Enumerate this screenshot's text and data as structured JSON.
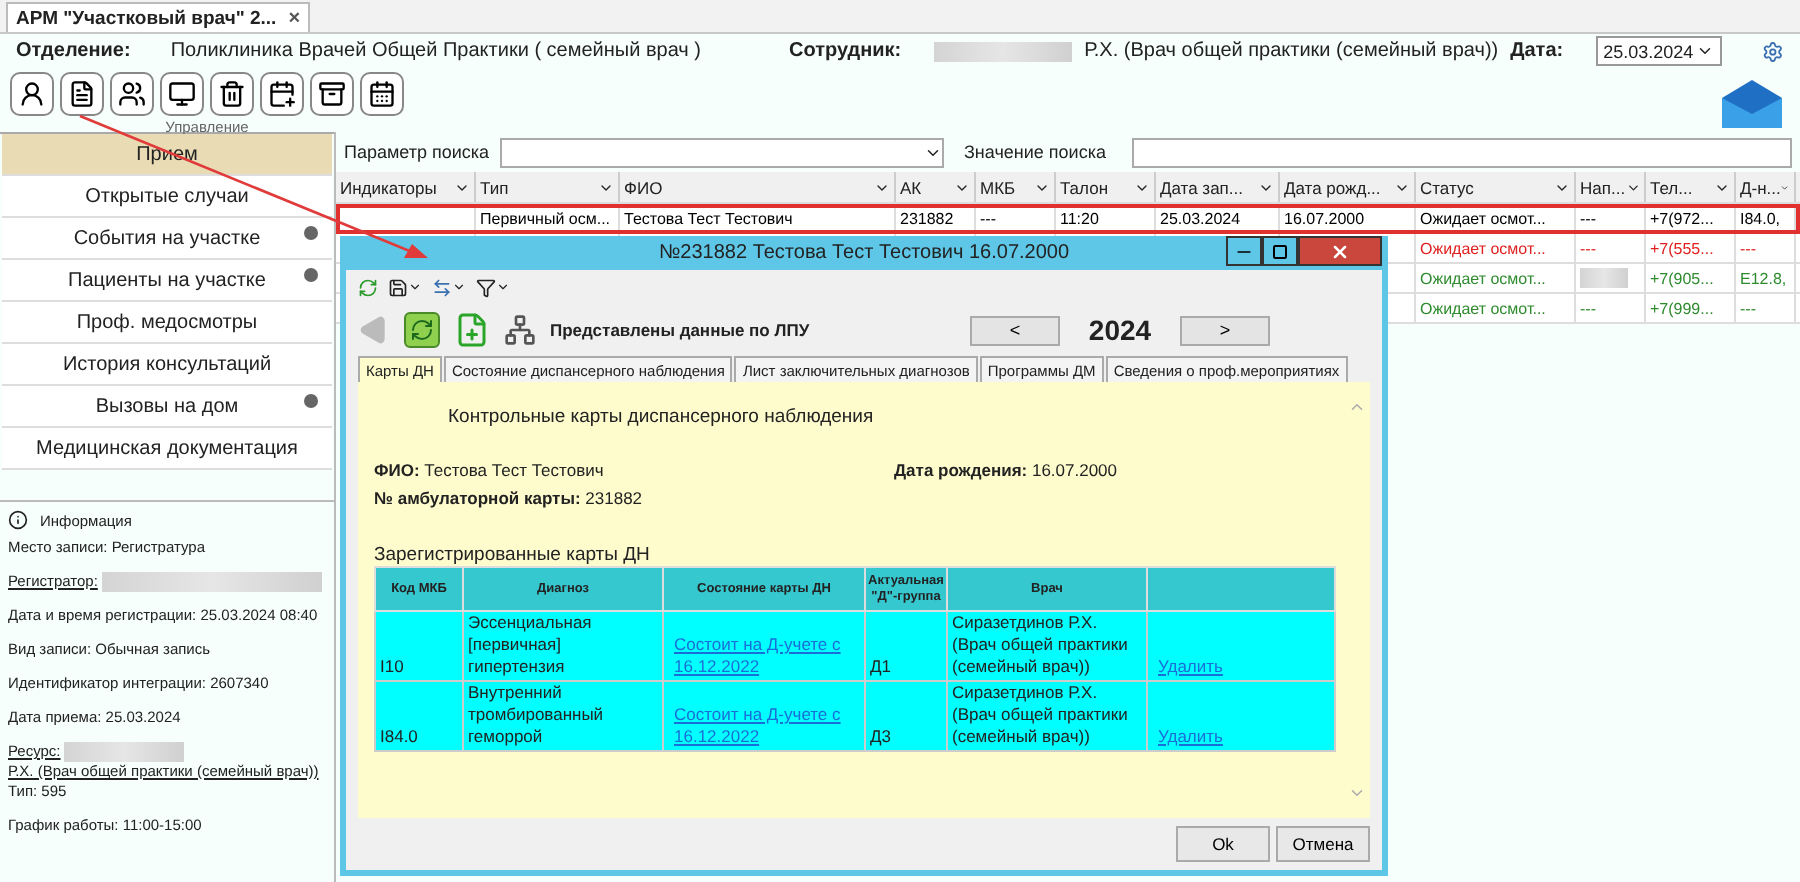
{
  "app_tab": {
    "title": "АРМ \"Участковый врач\" 2...",
    "close": "×"
  },
  "header": {
    "department_label": "Отделение:",
    "department": "Поликлиника Врачей Общей Практики ( семейный врач )",
    "employee_label": "Сотрудник:",
    "employee": "Р.Х. (Врач общей практики (семейный врач))",
    "date_label": "Дата:",
    "date": "25.03.2024"
  },
  "toolbar": {
    "group_label": "Управление"
  },
  "sidebar": {
    "items": [
      {
        "label": "Прием",
        "selected": true,
        "dot": false
      },
      {
        "label": "Открытые случаи",
        "selected": false,
        "dot": false
      },
      {
        "label": "События на участке",
        "selected": false,
        "dot": true
      },
      {
        "label": "Пациенты на участке",
        "selected": false,
        "dot": true
      },
      {
        "label": "Проф. медосмотры",
        "selected": false,
        "dot": false
      },
      {
        "label": "История консультаций",
        "selected": false,
        "dot": false
      },
      {
        "label": "Вызовы на дом",
        "selected": false,
        "dot": true
      },
      {
        "label": "Медицинская документация",
        "selected": false,
        "dot": false
      }
    ]
  },
  "info": {
    "title": "Информация",
    "fields": [
      {
        "kind": "text",
        "text": "Место записи: Регистратура"
      },
      {
        "kind": "link",
        "label": "Регистратор:",
        "redacted": true
      },
      {
        "kind": "text",
        "text": "Дата и время регистрации: 25.03.2024 08:40"
      },
      {
        "kind": "text",
        "text": "Вид записи: Обычная запись"
      },
      {
        "kind": "text",
        "text": "Идентификатор интеграции: 2607340"
      },
      {
        "kind": "text",
        "text": "Дата приема: 25.03.2024"
      },
      {
        "kind": "link",
        "label": "Ресурс:",
        "redacted": true,
        "text": "Р.Х. (Врач общей практики (семейный врач))"
      },
      {
        "kind": "note",
        "text": "Тип: 595"
      },
      {
        "kind": "text",
        "text": "График работы: 11:00-15:00"
      }
    ]
  },
  "search": {
    "param_label": "Параметр поиска",
    "value_label": "Значение поиска"
  },
  "table": {
    "columns": [
      "Индикаторы",
      "Тип",
      "ФИО",
      "АК",
      "МКБ",
      "Талон",
      "Дата зап...",
      "Дата рожд...",
      "Статус",
      "Нап...",
      "Тел...",
      "Д-н..."
    ],
    "rows": [
      {
        "selected": true,
        "redacted": false,
        "color": "#000000",
        "cells": [
          null,
          "Первичный осм...",
          "Тестова Тест Тестович",
          "231882",
          "---",
          "11:20",
          "25.03.2024",
          "16.07.2000",
          "Ожидает осмот...",
          "---",
          "+7(972...",
          "I84.0,"
        ]
      },
      {
        "selected": false,
        "redacted": false,
        "color": "#e02020",
        "cells": [
          null,
          null,
          null,
          null,
          null,
          null,
          null,
          null,
          "Ожидает осмот...",
          "---",
          "+7(555...",
          "---"
        ]
      },
      {
        "selected": false,
        "redacted": true,
        "color": "#2e8b2e",
        "cells": [
          null,
          null,
          null,
          null,
          null,
          null,
          null,
          null,
          "Ожидает осмот...",
          null,
          "+7(905...",
          "E12.8,"
        ]
      },
      {
        "selected": false,
        "redacted": false,
        "color": "#2e8b2e",
        "cells": [
          null,
          null,
          null,
          null,
          null,
          null,
          null,
          null,
          "Ожидает осмот...",
          "---",
          "+7(999...",
          "---"
        ]
      }
    ]
  },
  "dialog": {
    "title": "№231882 Тестова Тест Тестович 16.07.2000",
    "scope_label": "Представлены данные по ЛПУ",
    "prev": "<",
    "year": "2024",
    "next": ">",
    "tabs": [
      {
        "label": "Карты ДН",
        "selected": true
      },
      {
        "label": "Состояние диспансерного наблюдения",
        "selected": false
      },
      {
        "label": "Лист заключительных диагнозов",
        "selected": false
      },
      {
        "label": "Программы ДМ",
        "selected": false
      },
      {
        "label": "Сведения о проф.мероприятиях",
        "selected": false
      }
    ],
    "heading": "Контрольные карты диспансерного наблюдения",
    "fio": "**ФИО:** Тестова Тест Тестович",
    "birth": "**Дата рождения:** 16.07.2000",
    "card": "**№ амбулаторной карты:** 231882",
    "cards_title": "Зарегистрированные карты ДН",
    "columns": [
      "Код МКБ",
      "Диагноз",
      "Состояние карты ДН",
      "Актуальная \"Д\"-группа",
      "Врач"
    ],
    "rows": [
      {
        "code": "I10",
        "diagnosis": "Эссенциальная [первичная] гипертензия",
        "state": "Состоит на Д-учете с 16.12.2022",
        "group": "Д1",
        "doctor": "Сиразетдинов Р.Х. (Врач общей практики (семейный врач))",
        "action": "Удалить"
      },
      {
        "code": "I84.0",
        "diagnosis": "Внутренний тромбированный геморрой",
        "state": "Состоит на Д-учете с 16.12.2022",
        "group": "Д3",
        "doctor": "Сиразетдинов Р.Х. (Врач общей практики (семейный врач))",
        "action": "Удалить"
      }
    ],
    "buttons": [
      "Ok",
      "Отмена"
    ]
  }
}
